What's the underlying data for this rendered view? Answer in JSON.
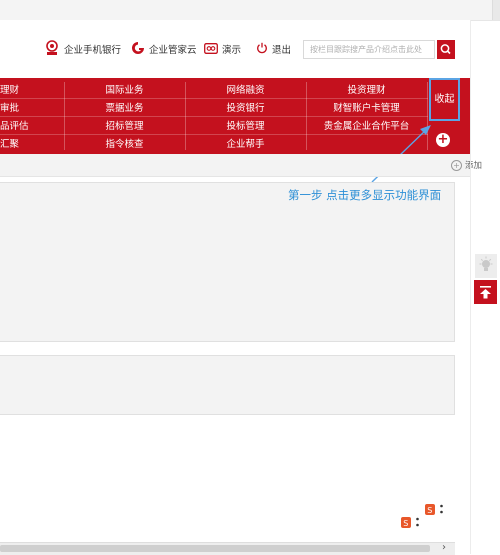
{
  "header": {
    "items": [
      {
        "label": "企业手机银行",
        "icon": "mobile-bank-icon"
      },
      {
        "label": "企业管家云",
        "icon": "cloud-logo-icon"
      },
      {
        "label": "演示",
        "icon": "demo-icon"
      },
      {
        "label": "退出",
        "icon": "power-icon"
      }
    ],
    "search_placeholder": "按栏目跟踪搜产品介绍点击此处"
  },
  "nav": {
    "rows": [
      [
        "理财",
        "国际业务",
        "网络融资",
        "投资理财"
      ],
      [
        "审批",
        "票据业务",
        "投资银行",
        "财智账户卡管理"
      ],
      [
        "品评估",
        "招标管理",
        "投标管理",
        "贵金属企业合作平台"
      ],
      [
        "汇聚",
        "指令核查",
        "企业帮手",
        ""
      ]
    ],
    "collapse_label": "收起",
    "more_symbol": "+"
  },
  "toolbar": {
    "add_label": "添加",
    "add_symbol": "+"
  },
  "annotation": "第一步 点击更多显示功能界面",
  "colors": {
    "brand_red": "#c4111e",
    "annotation_blue": "#2c8fd6",
    "highlight_blue": "#5ba4e4"
  },
  "scrollbar": {
    "arrow": "›"
  }
}
